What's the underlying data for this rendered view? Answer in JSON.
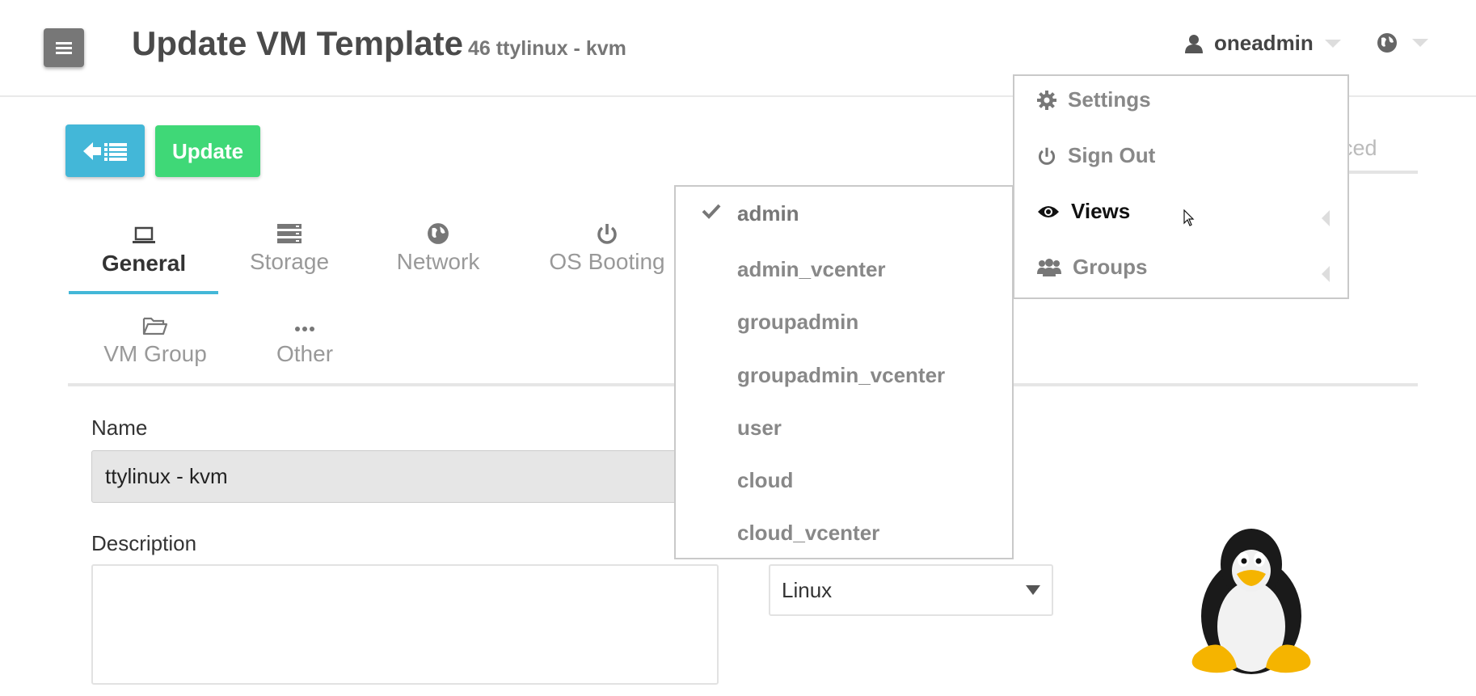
{
  "header": {
    "title": "Update VM Template",
    "subtitle": "46 ttylinux - kvm",
    "user": "oneadmin"
  },
  "toolbar": {
    "update_label": "Update",
    "advanced_partial": "ced"
  },
  "tabs": [
    {
      "label": "General",
      "icon": "laptop-icon",
      "active": true
    },
    {
      "label": "Storage",
      "icon": "storage-icon"
    },
    {
      "label": "Network",
      "icon": "globe-icon"
    },
    {
      "label": "OS Booting",
      "icon": "power-icon"
    },
    {
      "label": "VM Group",
      "icon": "folder-icon"
    },
    {
      "label": "Other",
      "icon": "ellipsis-icon"
    }
  ],
  "form": {
    "name_label": "Name",
    "name_value": "ttylinux - kvm",
    "description_label": "Description",
    "description_value": "",
    "os_value": "Linux"
  },
  "user_menu": {
    "items": [
      {
        "label": "Settings",
        "icon": "gear-icon"
      },
      {
        "label": "Sign Out",
        "icon": "power-icon"
      },
      {
        "label": "Views",
        "icon": "eye-icon",
        "highlighted": true
      },
      {
        "label": "Groups",
        "icon": "users-icon"
      }
    ]
  },
  "views_menu": {
    "items": [
      {
        "label": "admin",
        "checked": true
      },
      {
        "label": "admin_vcenter"
      },
      {
        "label": "groupadmin"
      },
      {
        "label": "groupadmin_vcenter"
      },
      {
        "label": "user"
      },
      {
        "label": "cloud"
      },
      {
        "label": "cloud_vcenter"
      }
    ]
  },
  "colors": {
    "accent": "#43b7d8",
    "success": "#3fd877",
    "menu_button": "#777777"
  }
}
